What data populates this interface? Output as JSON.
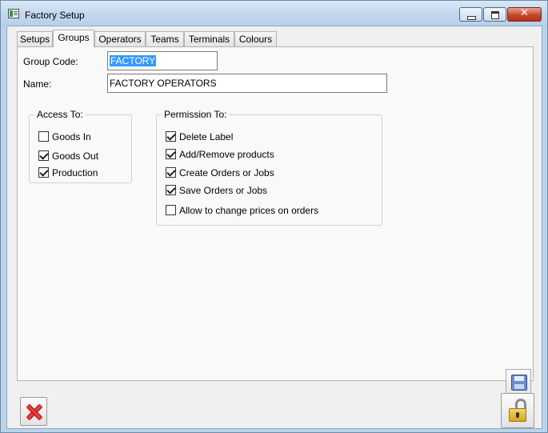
{
  "window": {
    "title": "Factory Setup",
    "close_glyph": "✕"
  },
  "tabs": [
    {
      "label": "Setups"
    },
    {
      "label": "Groups"
    },
    {
      "label": "Operators"
    },
    {
      "label": "Teams"
    },
    {
      "label": "Terminals"
    },
    {
      "label": "Colours"
    }
  ],
  "active_tab": "Groups",
  "form": {
    "group_code_label": "Group Code:",
    "group_code_value": "FACTORY",
    "name_label": "Name:",
    "name_value": "FACTORY OPERATORS"
  },
  "access": {
    "title": "Access To:",
    "items": [
      {
        "label": "Goods In",
        "checked": false
      },
      {
        "label": "Goods Out",
        "checked": true
      },
      {
        "label": "Production",
        "checked": true
      }
    ]
  },
  "permission": {
    "title": "Permission To:",
    "items": [
      {
        "label": "Delete Label",
        "checked": true
      },
      {
        "label": "Add/Remove products",
        "checked": true
      },
      {
        "label": "Create Orders or Jobs",
        "checked": true
      },
      {
        "label": "Save Orders or Jobs",
        "checked": true
      },
      {
        "label": "Allow to change prices on orders",
        "checked": false
      }
    ]
  },
  "icons": {
    "save": "floppy-disk-icon",
    "cancel": "red-x-icon",
    "lock": "padlock-icon"
  },
  "colors": {
    "selection": "#3399ff",
    "close_button": "#c9452c"
  }
}
